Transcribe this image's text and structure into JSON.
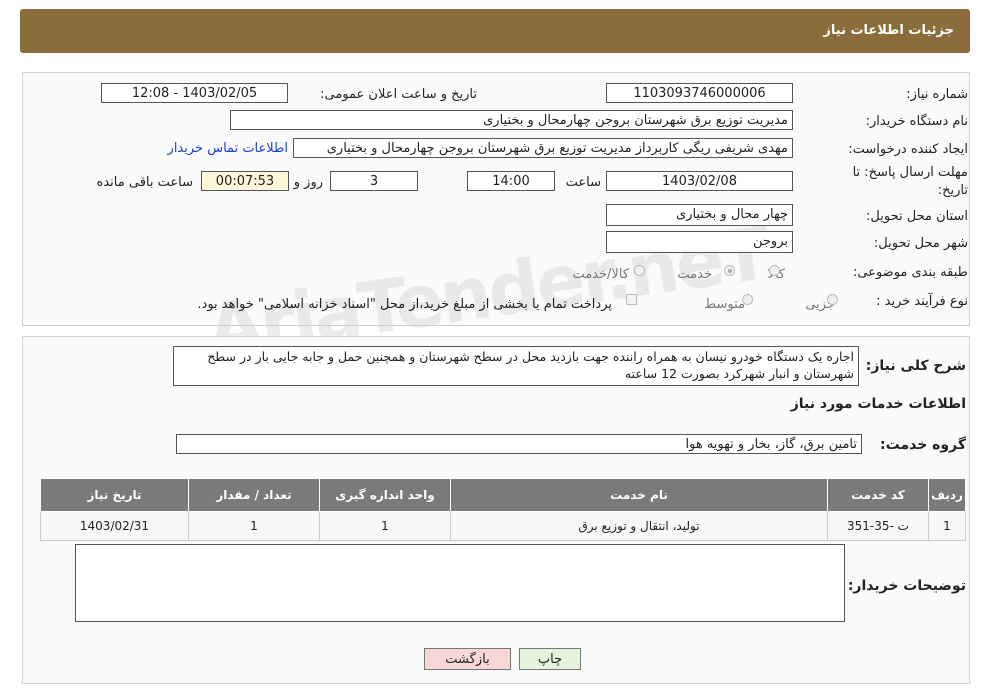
{
  "page": {
    "title": "جزئیات اطلاعات نیاز"
  },
  "form": {
    "need_number_label": "شماره نیاز:",
    "need_number": "1103093746000006",
    "announce_label": "تاریخ و ساعت اعلان عمومی:",
    "announce_value": "1403/02/05 - 12:08",
    "buyer_org_label": "نام دستگاه خریدار:",
    "buyer_org": "مدیریت توزیع برق شهرستان بروجن چهارمحال و بختیاری",
    "creator_label": "ایجاد کننده درخواست:",
    "creator": "مهدی شریفی ریگی کاربرداز مدیریت توزیع برق شهرستان بروجن چهارمحال و بختیاری",
    "contact_link": "اطلاعات تماس خریدار",
    "deadline_label_1": "مهلت ارسال پاسخ: تا",
    "deadline_label_2": "تاریخ:",
    "deadline_date": "1403/02/08",
    "time_label": "ساعت",
    "deadline_time": "14:00",
    "days_value": "3",
    "days_label": "روز و",
    "remaining_time": "00:07:53",
    "remaining_label": "ساعت باقی مانده",
    "province_label": "استان محل تحویل:",
    "province": "چهار محال و بختیاری",
    "city_label": "شهر محل تحویل:",
    "city": "بروجن",
    "category_label": "طبقه بندی موضوعی:",
    "category_options": [
      "کالا",
      "خدمت",
      "کالا/خدمت"
    ],
    "category_selected": "خدمت",
    "process_label": "نوع فرآیند خرید :",
    "process_options": [
      "جزیی",
      "متوسط"
    ],
    "payment_note": "پرداخت تمام یا بخشی از مبلغ خرید،از محل \"اسناد خزانه اسلامی\" خواهد بود."
  },
  "description": {
    "label": "شرح کلی نیاز:",
    "text": "اجاره یک دستگاه خودرو نیسان به همراه راننده جهت بازدید محل در سطح شهرستان  و همچنین حمل و جابه جایی بار در سطح شهرستان و انبار شهرکرد بصورت 12 ساعته"
  },
  "services": {
    "section_title": "اطلاعات خدمات مورد نیاز",
    "group_label": "گروه خدمت:",
    "group_value": "تامین برق، گاز، بخار و تهویه هوا",
    "table": {
      "headers": [
        "ردیف",
        "کد خدمت",
        "نام خدمت",
        "واحد اندازه گیری",
        "تعداد / مقدار",
        "تاریخ نیاز"
      ],
      "rows": [
        [
          "1",
          "ت -35-351",
          "تولید، انتقال و توزیع برق",
          "1",
          "1",
          "1403/02/31"
        ]
      ]
    }
  },
  "buyer_notes": {
    "label": "توضیحات خریدار:",
    "value": ""
  },
  "buttons": {
    "print": "چاپ",
    "back": "بازگشت"
  },
  "watermark": {
    "text": "AriaTender.neT"
  },
  "colors": {
    "header_bg": "#8a6d3b",
    "table_header_bg": "#7a7a7a",
    "link": "#1a3fcf",
    "back_button_bg": "#f8d7d7",
    "print_button_bg": "#e3f3dc"
  }
}
